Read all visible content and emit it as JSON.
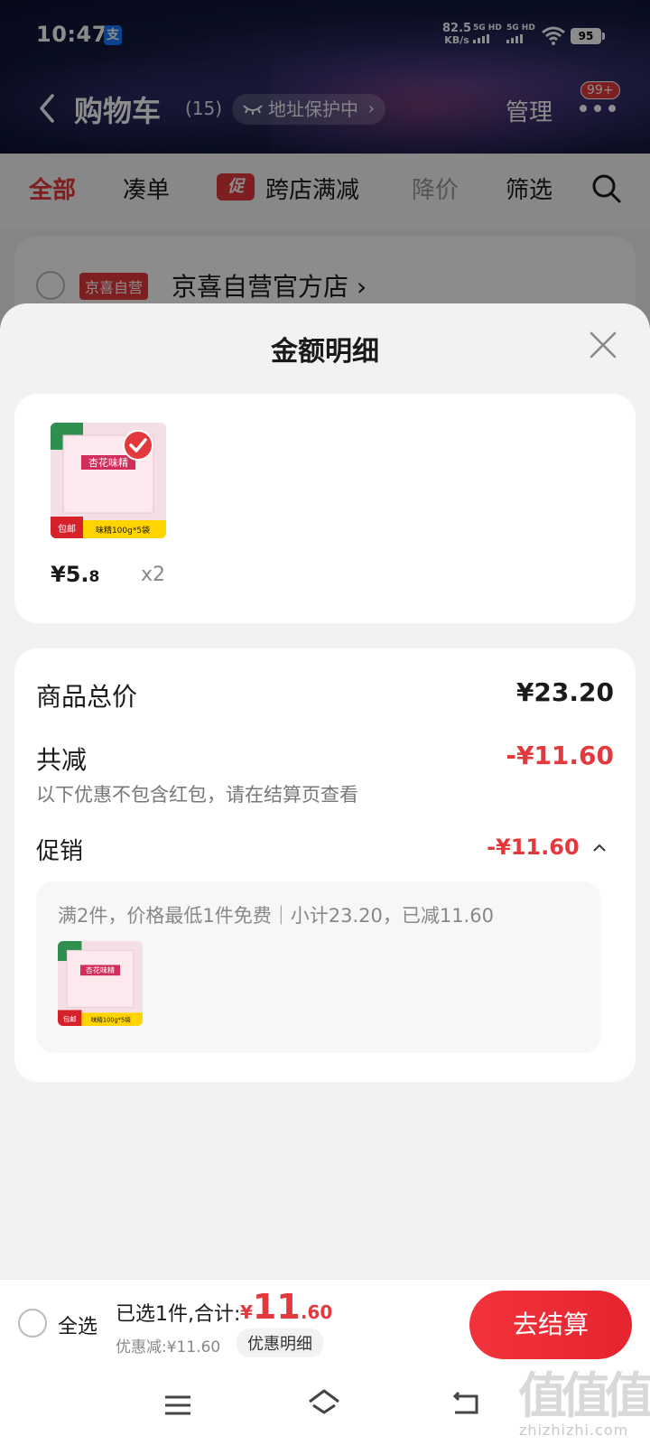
{
  "status": {
    "time": "10:47",
    "alipay": "支",
    "speed_value": "82.5",
    "speed_unit": "KB/s",
    "sig1": "5G HD",
    "sig2": "5G HD",
    "battery": "95"
  },
  "nav": {
    "title": "购物车",
    "count": "(15)",
    "address_badge": "地址保护中",
    "chevron": "›",
    "manage": "管理",
    "badge": "99+"
  },
  "filters": {
    "all": "全部",
    "combine": "凑单",
    "promo_tag": "促",
    "cross_store": "跨店满减",
    "price_drop": "降价",
    "filter": "筛选"
  },
  "shop": {
    "tag": "京喜自营",
    "name": "京喜自营官方店",
    "chevron": "›"
  },
  "sheet": {
    "title": "金额明细",
    "item": {
      "price_int": "¥5.",
      "price_dec": "8",
      "qty": "x2",
      "thumb_text_1": "杏花味精",
      "thumb_text_2": "味精100g*5袋",
      "thumb_text_3": "包邮"
    },
    "total_label": "商品总价",
    "total_value": "¥23.20",
    "reduce_label": "共减",
    "reduce_value": "-¥11.60",
    "note": "以下优惠不包含红包，请在结算页查看",
    "promo_label": "促销",
    "promo_value": "-¥11.60",
    "promo_desc": "满2件，价格最低1件免费｜小计23.20，已减11.60"
  },
  "footer": {
    "select_all": "全选",
    "selected": "已选1件,合计:",
    "yen": "¥",
    "total_int": "11",
    "total_dec": ".60",
    "saved": "优惠减:¥11.60",
    "detail_btn": "优惠明细",
    "checkout": "去结算"
  },
  "watermark": {
    "main": "值值值",
    "sub": "zhizhizhi.com"
  },
  "colors": {
    "accent": "#e4393c",
    "sheet_bg": "#f2f2f2"
  }
}
